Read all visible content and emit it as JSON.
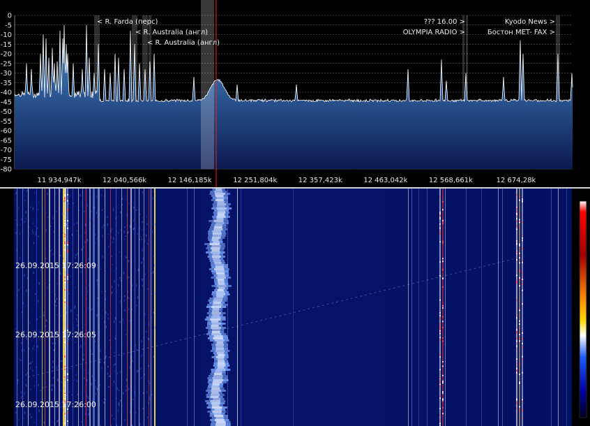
{
  "spectrum": {
    "y_axis": {
      "min": -80,
      "max": 0,
      "step": 5,
      "ticks": [
        "0",
        "-5",
        "-10",
        "-15",
        "-20",
        "-25",
        "-30",
        "-35",
        "-40",
        "-45",
        "-50",
        "-55",
        "-60",
        "-65",
        "-70",
        "-75",
        "-80"
      ]
    },
    "freq_labels": [
      {
        "label": "11 934,947k",
        "khz": 11934947
      },
      {
        "label": "12 040,566k",
        "khz": 12040566
      },
      {
        "label": "12 146,185k",
        "khz": 12146185
      },
      {
        "label": "12 251,804k",
        "khz": 12251804
      },
      {
        "label": "12 357,423k",
        "khz": 12357423
      },
      {
        "label": "12 463,042k",
        "khz": 12463042
      },
      {
        "label": "12 568,661k",
        "khz": 12568661
      },
      {
        "label": "12 674,28k",
        "khz": 12674280
      }
    ],
    "markers": [
      {
        "text": "< R. Farda (перс)",
        "khz": 12015000
      },
      {
        "text": "< R. Australia (англ)",
        "khz": 12070000
      },
      {
        "text": "< R. Australia (англ)",
        "khz": 12095000
      },
      {
        "text": "??? 16.00 >",
        "khz": 12565000
      },
      {
        "text": "OLYMPIA RADIO >",
        "khz": 12565000
      },
      {
        "text": "Kyodo News >",
        "khz": 12690000
      },
      {
        "text": "Бостон MET- FAX >",
        "khz": 12690000
      }
    ],
    "noise_floor_db": -45,
    "tuned_khz": 12165000,
    "filter_width_khz": 20000,
    "colors": {
      "fill_top": "#4a90d0",
      "fill_bottom": "#0b1a50",
      "trace": "#ffffff",
      "tuned_line": "#ff2020",
      "grid": "#7a7a7a"
    }
  },
  "waterfall": {
    "timestamps": [
      "26.09.2015 17:26:09",
      "26.09.2015 17:26:05",
      "26.09.2015 17:26:00"
    ],
    "colorbar": [
      "#ffffff",
      "#ff0000",
      "#ff8c00",
      "#ffd700",
      "#ffffff",
      "#1e5bff",
      "#0000a0",
      "#000020"
    ]
  }
}
